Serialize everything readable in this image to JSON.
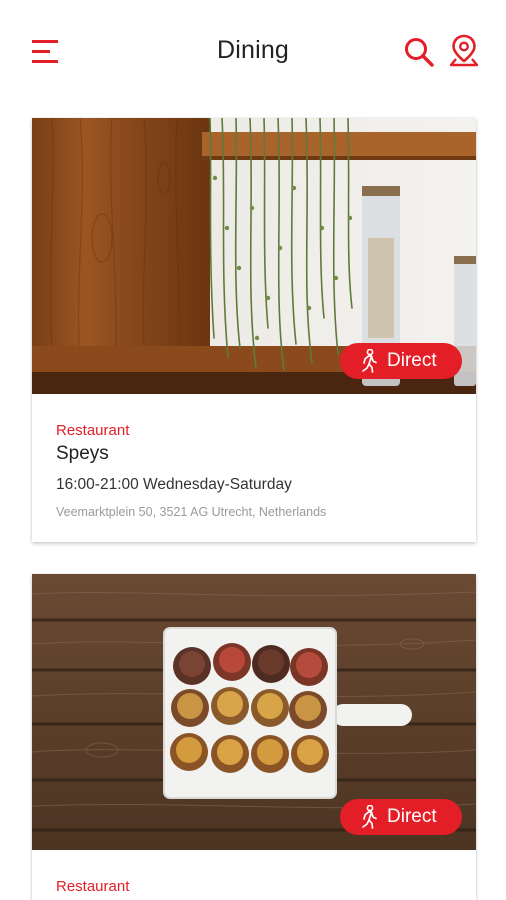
{
  "header": {
    "title": "Dining"
  },
  "colors": {
    "accent": "#e41e26",
    "text": "#222222",
    "muted": "#9a9a9a"
  },
  "icons": {
    "menu": "menu-icon",
    "search": "search-icon",
    "location": "location-pin-icon",
    "walking": "walking-person-icon"
  },
  "cards": [
    {
      "category": "Restaurant",
      "name": "Speys",
      "hours": "16:00-21:00 Wednesday-Saturday",
      "address": "Veemarktplein 50, 3521 AG Utrecht, Netherlands",
      "badge": "Direct"
    },
    {
      "category": "Restaurant",
      "badge": "Direct"
    }
  ]
}
